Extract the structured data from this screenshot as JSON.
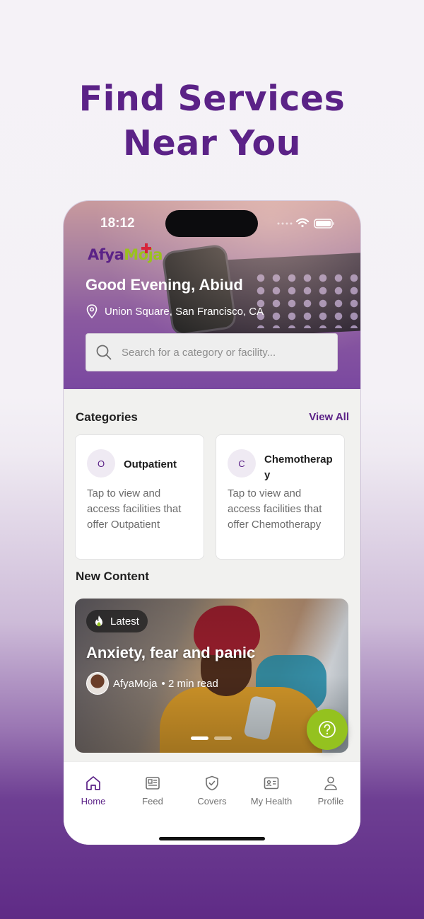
{
  "headline": {
    "line1": "Find Services",
    "line2": "Near You"
  },
  "status_bar": {
    "time": "18:12"
  },
  "logo": {
    "part1": "Afya",
    "part2": "Moja"
  },
  "header": {
    "greeting": "Good Evening, Abiud",
    "location": "Union Square, San Francisco, CA"
  },
  "search": {
    "placeholder": "Search for a category or facility..."
  },
  "categories": {
    "title": "Categories",
    "view_all": "View All",
    "items": [
      {
        "initial": "O",
        "name": "Outpatient",
        "description": "Tap to view and access facilities that offer Outpatient"
      },
      {
        "initial": "C",
        "name": "Chemotherapy",
        "description": "Tap to view and access facilities that offer Chemotherapy"
      }
    ]
  },
  "new_content": {
    "title": "New Content",
    "card": {
      "badge": "Latest",
      "title": "Anxiety, fear and panic",
      "author": "AfyaMoja",
      "read_time": "• 2 min read",
      "active_slide": 1,
      "slides": 2
    }
  },
  "tabbar": {
    "items": [
      {
        "label": "Home",
        "icon": "home-icon",
        "active": true
      },
      {
        "label": "Feed",
        "icon": "feed-icon",
        "active": false
      },
      {
        "label": "Covers",
        "icon": "shield-check-icon",
        "active": false
      },
      {
        "label": "My Health",
        "icon": "id-card-icon",
        "active": false
      },
      {
        "label": "Profile",
        "icon": "person-icon",
        "active": false
      }
    ]
  },
  "colors": {
    "brand_purple": "#5b2287",
    "brand_green": "#94c21f"
  }
}
